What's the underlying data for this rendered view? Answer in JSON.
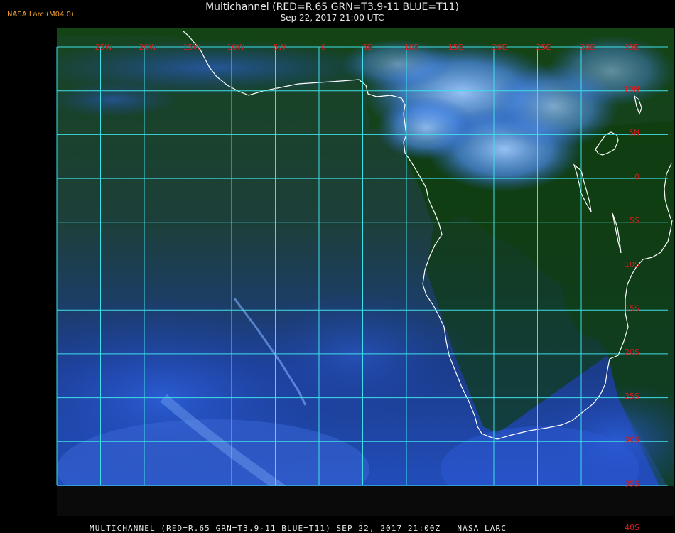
{
  "header": {
    "credit": "NASA Larc (M04.0)",
    "title": "Multichannel (RED=R.65 GRN=T3.9-11 BLUE=T11)",
    "subtitle": "Sep 22, 2017 21:00 UTC"
  },
  "footer": {
    "caption": "MULTICHANNEL (RED=R.65 GRN=T3.9-11 BLUE=T11) SEP 22, 2017 21:00Z   NASA LARC"
  },
  "map": {
    "region": "Southern Africa and South-East Atlantic",
    "grid_color": "#3ee0e8",
    "label_color": "#d21e1e",
    "coast_color": "#ffffff",
    "lon_labels": [
      "25W",
      "20W",
      "15W",
      "10W",
      "5W",
      "0",
      "5E",
      "10E",
      "15E",
      "20E",
      "25E",
      "30E",
      "35E"
    ],
    "lat_labels": [
      "10N",
      "5N",
      "0",
      "5S",
      "10S",
      "15S",
      "20S",
      "25S",
      "30S",
      "35S",
      "40S"
    ]
  }
}
